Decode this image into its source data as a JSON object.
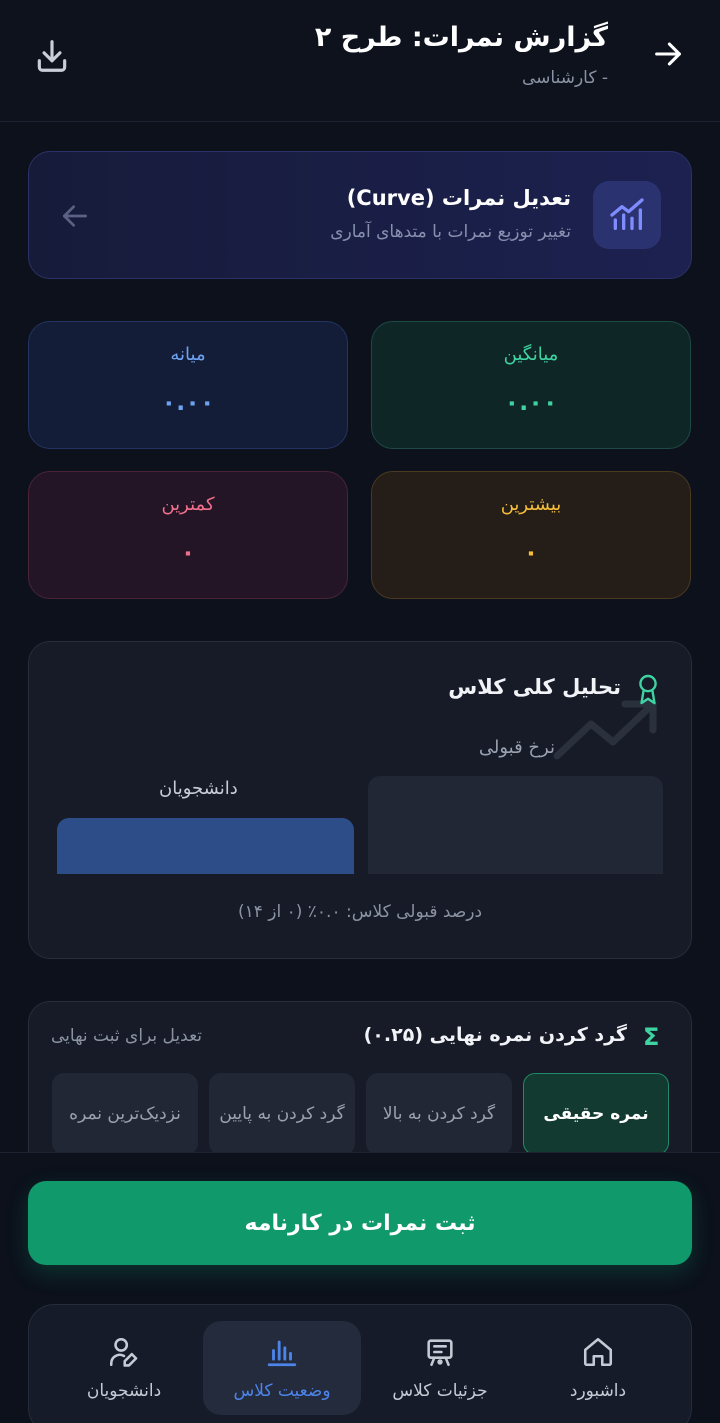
{
  "header": {
    "title": "گزارش نمرات: طرح ۲",
    "subtitle": "- کارشناسی"
  },
  "curve_card": {
    "title": "تعدیل نمرات (Curve)",
    "description": "تغییر توزیع نمرات با متدهای آماری"
  },
  "stats": {
    "median": {
      "label": "میانه",
      "value": "۰.۰۰"
    },
    "mean": {
      "label": "میانگین",
      "value": "۰.۰۰"
    },
    "min": {
      "label": "کمترین",
      "value": "۰"
    },
    "max": {
      "label": "بیشترین",
      "value": "۰"
    }
  },
  "analysis": {
    "title": "تحلیل کلی کلاس",
    "pass_rate_label": "نرخ قبولی",
    "students_label": "دانشجویان",
    "summary": "درصد قبولی کلاس: ۰.۰٪ (۰ از ۱۴)"
  },
  "rounding": {
    "title": "گرد کردن نمره نهایی (۰.۲۵)",
    "note": "تعدیل برای ثبت نهایی",
    "options": [
      "نمره حقیقی",
      "گرد کردن به بالا",
      "گرد کردن به پایین",
      "نزدیک‌ترین نمره"
    ],
    "selected": "نمره حقیقی"
  },
  "submit_label": "ثبت نمرات در کارنامه",
  "nav": {
    "dashboard": "داشبورد",
    "details": "جزئیات کلاس",
    "status": "وضعیت کلاس",
    "students": "دانشجویان",
    "active": "status"
  },
  "colors": {
    "accent_green": "#10996b",
    "accent_blue": "#4d84ea",
    "background": "#0c111c"
  }
}
